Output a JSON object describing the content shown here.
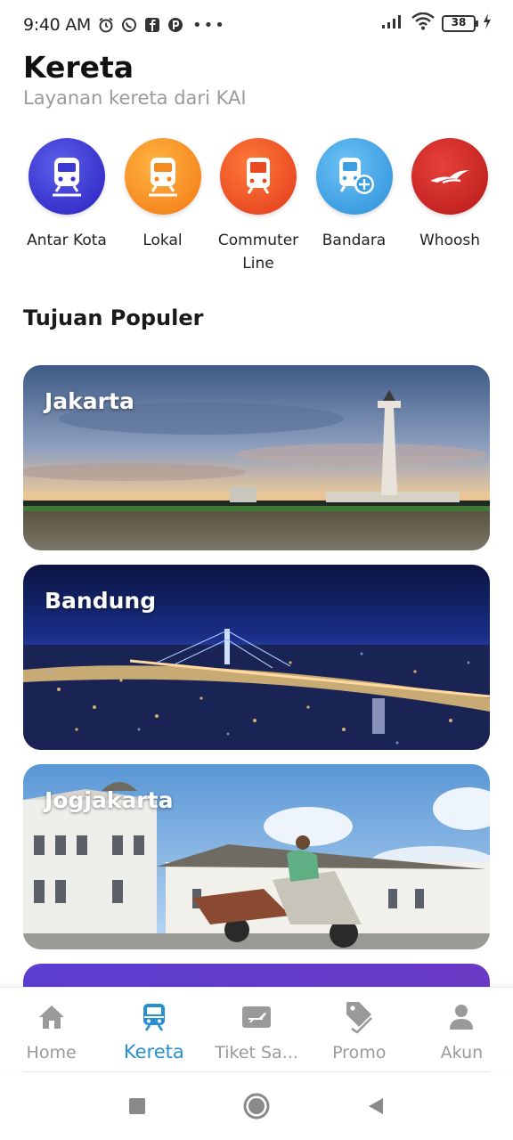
{
  "status_bar": {
    "time": "9:40 AM",
    "dots": "•••",
    "battery_level": "38"
  },
  "header": {
    "title": "Kereta",
    "subtitle": "Layanan kereta dari KAI"
  },
  "categories": [
    {
      "label": "Antar Kota",
      "icon": "train-icon",
      "color_from": "#4b4fe0",
      "color_to": "#2f24c4"
    },
    {
      "label": "Lokal",
      "icon": "train-icon",
      "color_from": "#ffa530",
      "color_to": "#f27a12"
    },
    {
      "label": "Commuter Line",
      "icon": "train-icon",
      "color_from": "#ff6b2e",
      "color_to": "#e03a18"
    },
    {
      "label": "Bandara",
      "icon": "airport-train-icon",
      "color_from": "#55b3f2",
      "color_to": "#2a8fd8"
    },
    {
      "label": "Whoosh",
      "icon": "whoosh-logo-icon",
      "color_from": "#e0332e",
      "color_to": "#b81c1a"
    }
  ],
  "section": {
    "title": "Tujuan Populer"
  },
  "destinations": [
    {
      "label": "Jakarta"
    },
    {
      "label": "Bandung"
    },
    {
      "label": "Jogjakarta"
    }
  ],
  "bottom_nav": [
    {
      "label": "Home",
      "icon": "home-icon",
      "active": false
    },
    {
      "label": "Kereta",
      "icon": "train-icon",
      "active": true
    },
    {
      "label": "Tiket Sa...",
      "icon": "ticket-plane-icon",
      "active": false
    },
    {
      "label": "Promo",
      "icon": "tag-icon",
      "active": false
    },
    {
      "label": "Akun",
      "icon": "user-icon",
      "active": false
    }
  ],
  "colors": {
    "accent": "#2a8fd1",
    "inactive": "#9a9a9a"
  }
}
